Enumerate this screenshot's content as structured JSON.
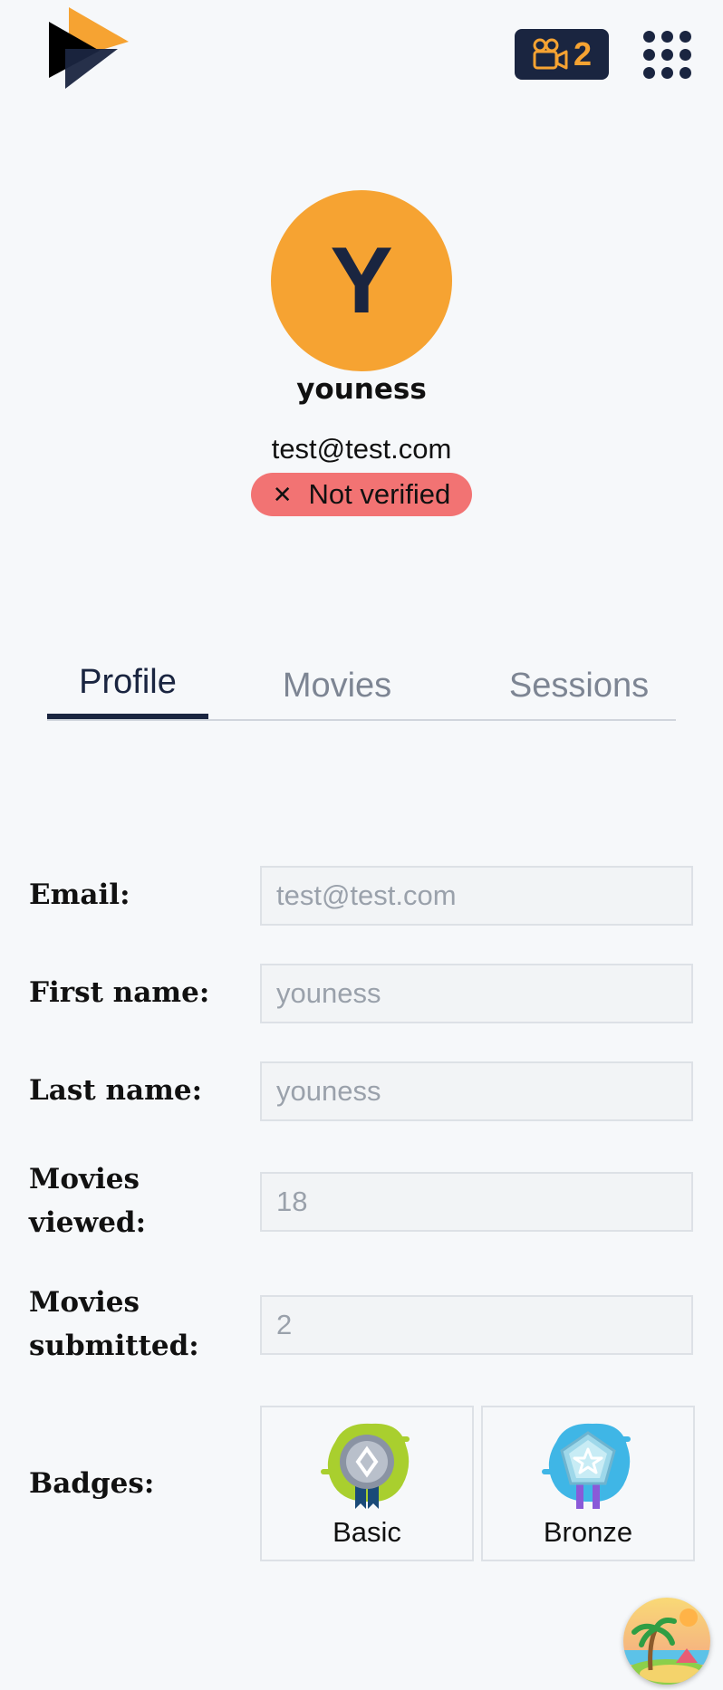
{
  "header": {
    "session_count": "2",
    "logo_icon": "play-logo-icon",
    "camera_icon": "movie-camera-icon",
    "menu_icon": "apps-grid-icon"
  },
  "profile": {
    "avatar_initial": "Y",
    "username": "youness",
    "email": "test@test.com",
    "verify_status": "Not verified",
    "verify_icon": "close-icon"
  },
  "tabs": [
    {
      "label": "Profile",
      "active": true
    },
    {
      "label": "Movies",
      "active": false
    },
    {
      "label": "Sessions",
      "active": false
    }
  ],
  "form": {
    "email": {
      "label": "Email:",
      "value": "test@test.com"
    },
    "first_name": {
      "label": "First name:",
      "value": "youness"
    },
    "last_name": {
      "label": "Last name:",
      "value": "youness"
    },
    "movies_viewed": {
      "label_line1": "Movies",
      "label_line2": "viewed:",
      "value": "18"
    },
    "movies_submitted": {
      "label_line1": "Movies",
      "label_line2": "submitted:",
      "value": "2"
    },
    "badges": {
      "label": "Badges:",
      "items": [
        {
          "name": "Basic",
          "icon": "basic-badge-icon"
        },
        {
          "name": "Bronze",
          "icon": "bronze-badge-icon"
        }
      ]
    }
  },
  "colors": {
    "accent": "#f6a332",
    "navy": "#1a2540",
    "danger": "#f27373",
    "background": "#f6f8fa"
  }
}
